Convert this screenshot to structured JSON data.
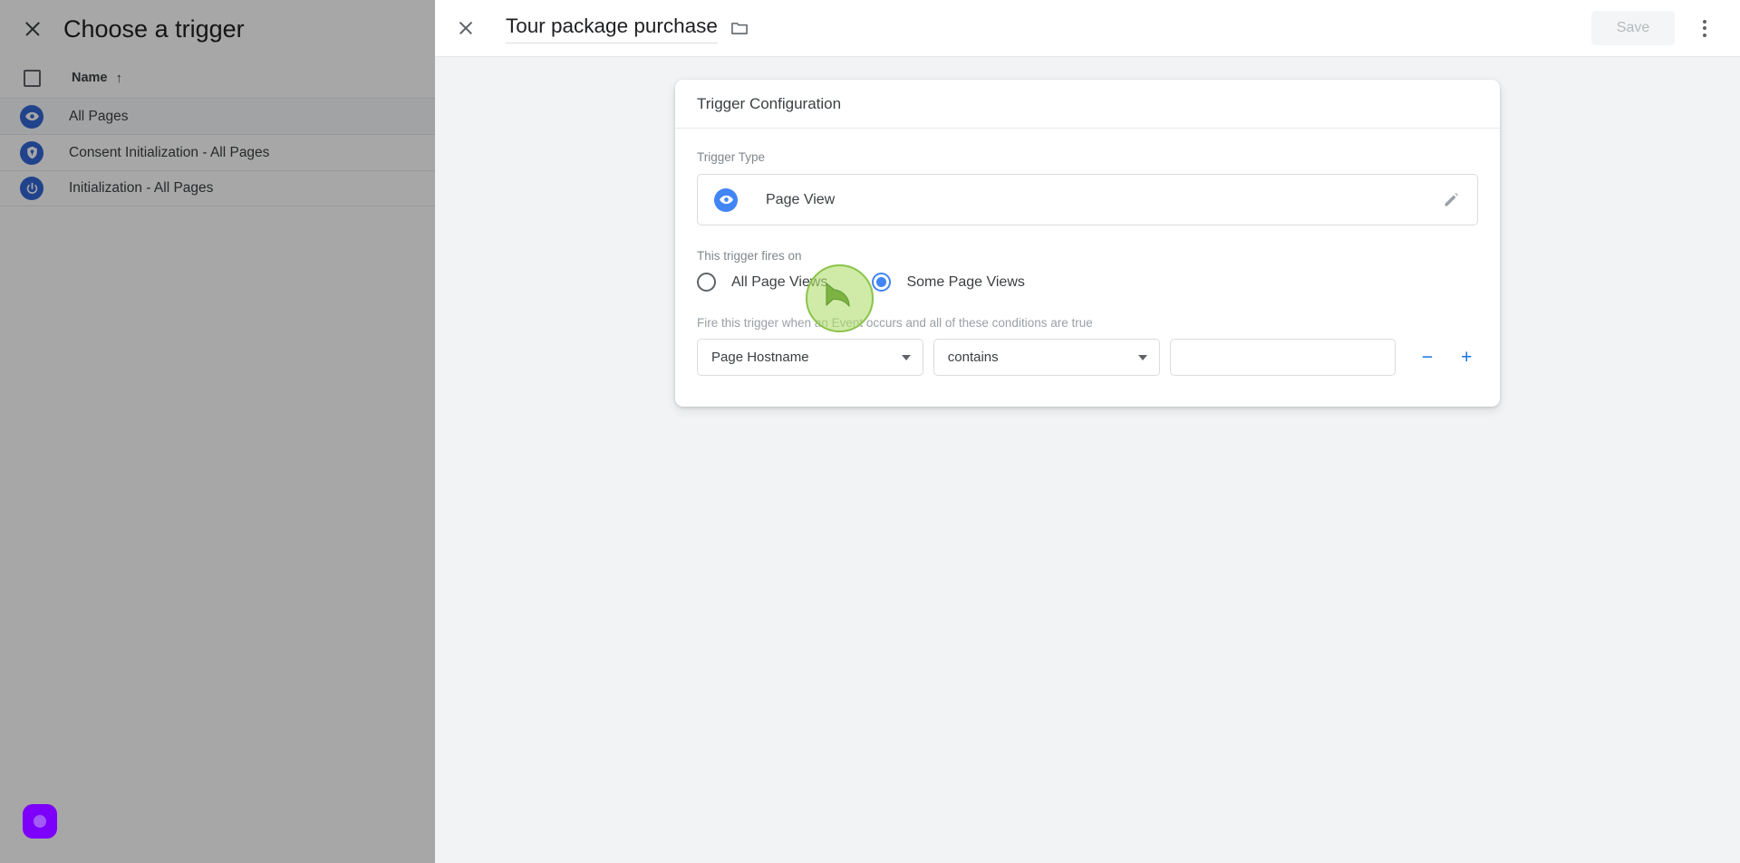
{
  "backdrop": {
    "close_icon": "close-icon",
    "title": "Choose a trigger",
    "table": {
      "select_all_checkbox": "select-all-checkbox",
      "columns": [
        "Name"
      ],
      "sort_arrow": "↑",
      "rows": [
        {
          "icon": "eye-icon",
          "label": "All Pages"
        },
        {
          "icon": "shield-icon",
          "label": "Consent Initialization - All Pages"
        },
        {
          "icon": "power-icon",
          "label": "Initialization - All Pages"
        }
      ]
    }
  },
  "modal": {
    "close_icon": "close-icon",
    "name": "Tour package purchase",
    "folder_icon": "folder-icon",
    "save_label": "Save",
    "save_enabled": false,
    "more_icon": "more-vert-icon",
    "card": {
      "title": "Trigger Configuration",
      "trigger_type": {
        "label": "Trigger Type",
        "icon": "page-view-eye-icon",
        "value": "Page View",
        "edit_icon": "pencil-icon"
      },
      "fires_on": {
        "label": "This trigger fires on",
        "options": [
          {
            "label": "All Page Views",
            "selected": false
          },
          {
            "label": "Some Page Views",
            "selected": true
          }
        ]
      },
      "conditions": {
        "hint": "Fire this trigger when an Event occurs and all of these conditions are true",
        "rows": [
          {
            "variable": "Page Hostname",
            "operator": "contains",
            "value": "",
            "value_placeholder": "",
            "remove_label": "−",
            "add_label": "+"
          }
        ]
      }
    }
  },
  "overlay": {
    "cursor": "green-click-cursor",
    "extension_badge": "purple-record-badge"
  },
  "colors": {
    "accent_blue": "#1a73e8",
    "trigger_icon_blue": "#4285f4",
    "cursor_green": "#8bc34a",
    "badge_purple": "#7c00fa",
    "page_bg": "#f1f3f4"
  }
}
